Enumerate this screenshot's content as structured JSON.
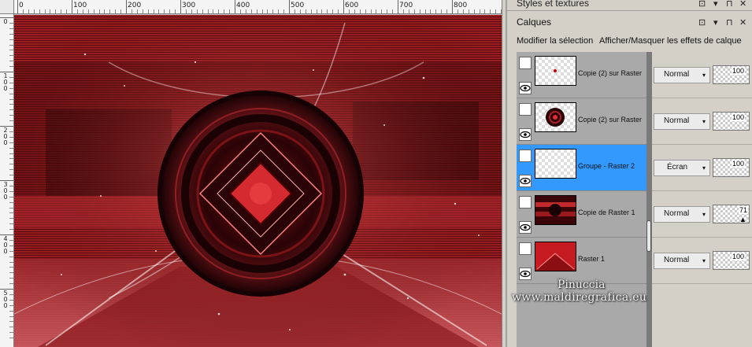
{
  "ruler": {
    "top_labels": [
      "0",
      "100",
      "200",
      "300",
      "400",
      "500",
      "600",
      "700",
      "800"
    ],
    "left_labels": [
      "0",
      "100",
      "200",
      "300",
      "400",
      "500"
    ]
  },
  "panels": {
    "styles_title": "Styles et textures",
    "calques_title": "Calques",
    "menu": {
      "modify_selection": "Modifier la sélection",
      "toggle_effects": "Afficher/Masquer les effets de calque"
    },
    "buttons": {
      "close": "✕",
      "pin": "⊓",
      "dropdown": "▾",
      "float": "⊡"
    }
  },
  "layers": [
    {
      "name": "Copie (2) sur Raster",
      "blend": "Normal",
      "opacity": "100",
      "selected": false
    },
    {
      "name": "Copie (2) sur Raster",
      "blend": "Normal",
      "opacity": "100",
      "selected": false
    },
    {
      "name": "Groupe - Raster 2",
      "blend": "Écran",
      "opacity": "100",
      "selected": true
    },
    {
      "name": "Copie de Raster 1",
      "blend": "Normal",
      "opacity": "71",
      "selected": false
    },
    {
      "name": "Raster 1",
      "blend": "Normal",
      "opacity": "100",
      "selected": false
    }
  ],
  "watermark": {
    "line1": "Pinuccia",
    "line2": "www.maldiregrafica.eu"
  },
  "colors": {
    "selection": "#3399ff",
    "canvas_red": "#8b1a1e",
    "panel_bg": "#d4d0c8"
  }
}
